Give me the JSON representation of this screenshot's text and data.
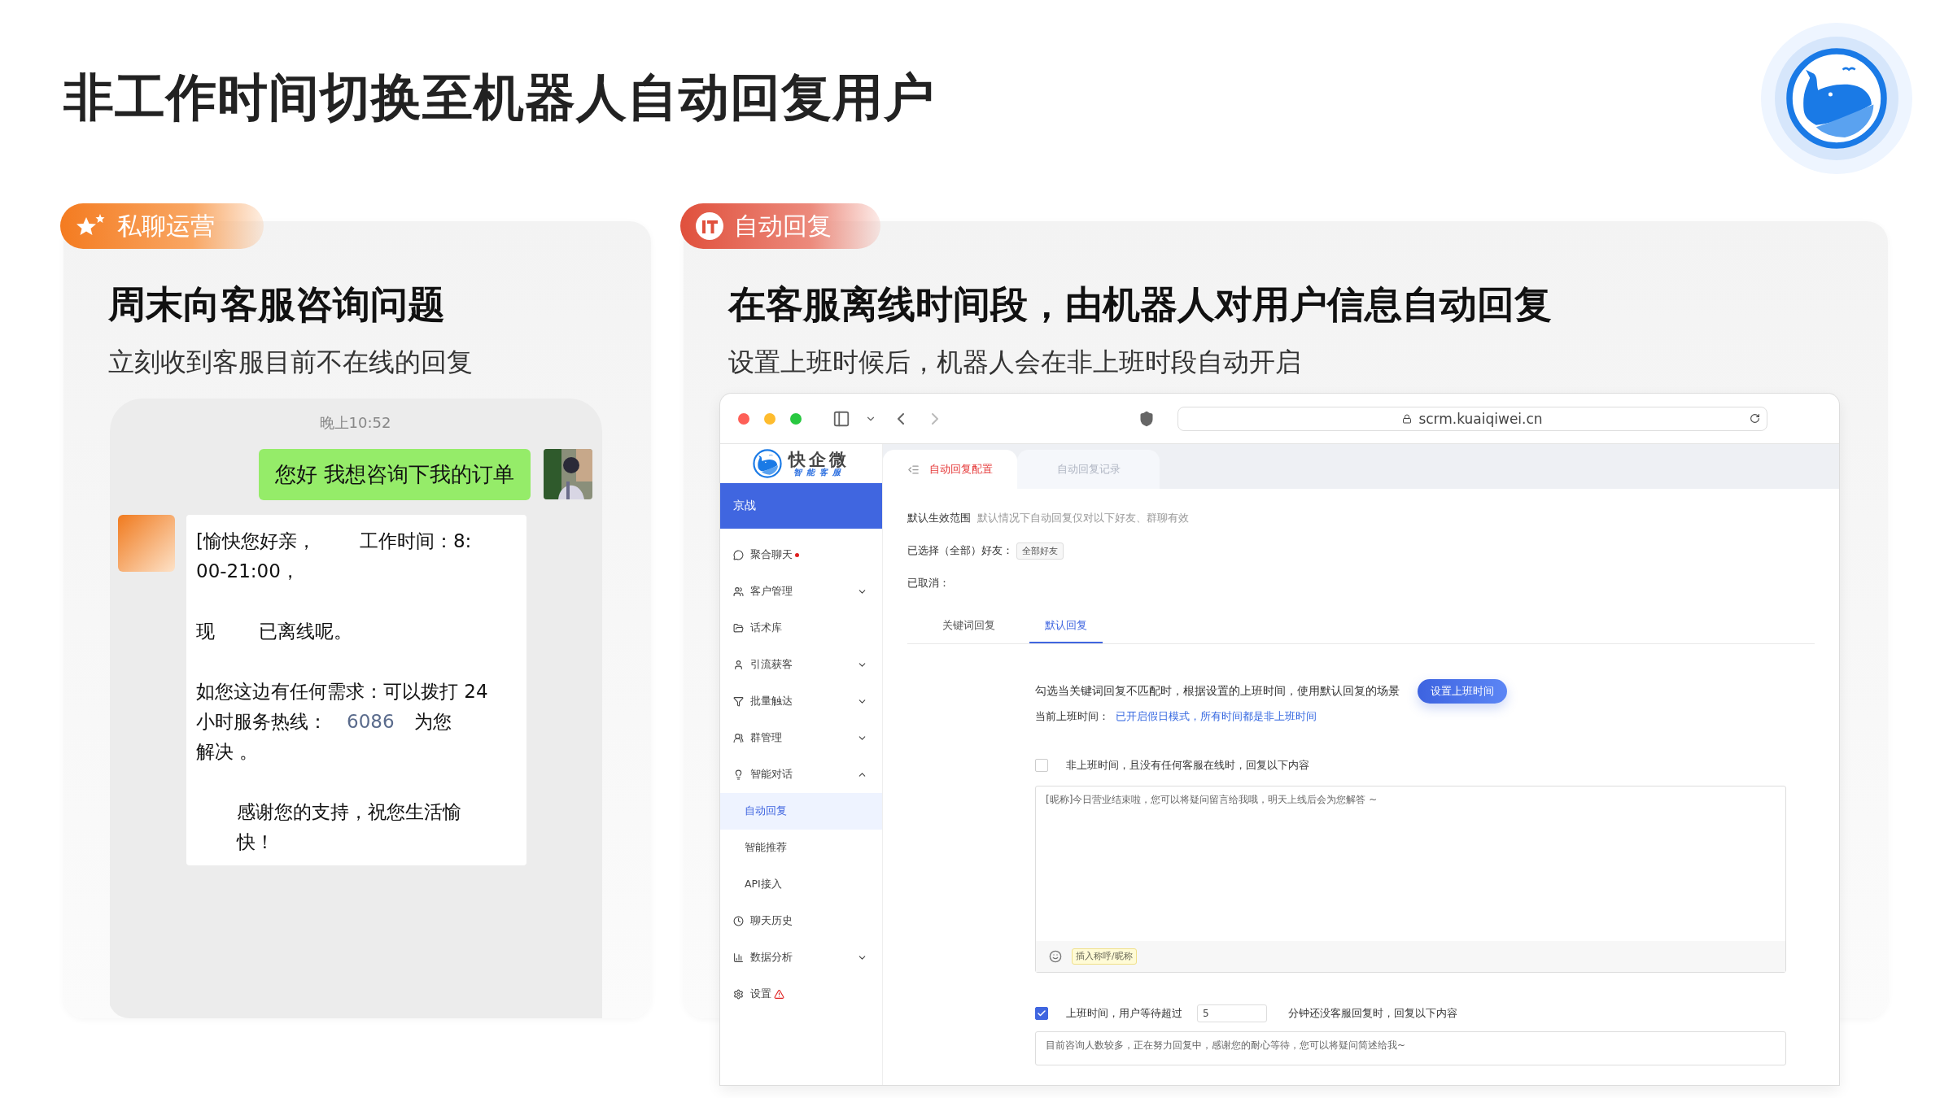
{
  "title": "非工作时间切换至机器人自动回复用户",
  "panels": [
    {
      "kind": "chat",
      "badge": {
        "label": "私聊运营",
        "kind": "star"
      },
      "heading": "周末向客服咨询问题",
      "subheading": "立刻收到客服目前不在线的回复",
      "chat": {
        "time": "晚上10:52",
        "outgoing": "您好 我想咨询下我的订单",
        "reply": [
          {
            "indent": false,
            "lines": [
              [
                {
                  "text": "[愉快您好亲，",
                  "highlight": false
                },
                {
                  "text": "工作时间：8:",
                  "highlight": false
                }
              ],
              [
                {
                  "text": "00-21:00，",
                  "highlight": false
                }
              ]
            ]
          },
          {
            "indent": false,
            "lines": [
              [
                {
                  "text": "现",
                  "highlight": false
                },
                {
                  "text": "已离线呢。",
                  "highlight": false
                }
              ]
            ]
          },
          {
            "indent": false,
            "lines": [
              [
                {
                  "text": "如您这边有任何需求：可以拨打 24",
                  "highlight": false
                }
              ],
              [
                {
                  "text": "小时服务热线：",
                  "highlight": false
                },
                {
                  "text": "6086",
                  "highlight": true
                },
                {
                  "text": "为您",
                  "highlight": false
                }
              ],
              [
                {
                  "text": "解决 。",
                  "highlight": false
                }
              ]
            ]
          },
          {
            "indent": true,
            "lines": [
              [
                {
                  "text": "感谢您的支持，祝您生活愉",
                  "highlight": false
                }
              ],
              [
                {
                  "text": "快！",
                  "highlight": false
                }
              ]
            ]
          }
        ]
      }
    },
    {
      "kind": "browser",
      "badge": {
        "label": "自动回复",
        "kind": "tile"
      },
      "heading": "在客服离线时间段，由机器人对用户信息自动回复",
      "subheading": "设置上班时候后，机器人会在非上班时段自动开启",
      "browser": {
        "url": "scrm.kuaiqiwei.cn",
        "brand": {
          "name": "快企微",
          "tagline": "智能客服"
        },
        "account": "京战",
        "nav": [
          {
            "label": "聚合聊天",
            "unread": true,
            "warning": false
          },
          {
            "label": "客户管理",
            "expanded": false,
            "unread": false,
            "warning": false
          },
          {
            "label": "话术库",
            "unread": false,
            "warning": false
          },
          {
            "label": "引流获客",
            "expanded": false,
            "unread": false,
            "warning": false
          },
          {
            "label": "批量触达",
            "expanded": false,
            "unread": false,
            "warning": false
          },
          {
            "label": "群管理",
            "expanded": false,
            "unread": false,
            "warning": false
          },
          {
            "label": "智能对话",
            "expanded": true,
            "unread": false,
            "warning": false,
            "children": [
              {
                "label": "自动回复",
                "selected": true
              },
              {
                "label": "智能推荐",
                "selected": false
              },
              {
                "label": "API接入",
                "selected": false
              }
            ]
          },
          {
            "label": "聊天历史",
            "unread": false,
            "warning": false
          },
          {
            "label": "数据分析",
            "expanded": false,
            "unread": false,
            "warning": false
          },
          {
            "label": "设置",
            "unread": false,
            "warning": true
          }
        ],
        "tabs": [
          {
            "label": "自动回复配置",
            "selected": true
          },
          {
            "label": "自动回复记录",
            "selected": false
          }
        ],
        "scope": {
          "label": "默认生效范围",
          "hint": "默认情况下自动回复仅对以下好友、群聊有效"
        },
        "selected_label": "已选择（全部）好友：",
        "selected_tag": "全部好友",
        "cancelled_label": "已取消：",
        "subtabs": [
          {
            "label": "关键词回复",
            "selected": false
          },
          {
            "label": "默认回复",
            "selected": true
          }
        ],
        "description": "勾选当关键词回复不匹配时，根据设置的上班时间，使用默认回复的场景",
        "set_time_button": "设置上班时间",
        "current_label": "当前上班时间：",
        "current_value": "已开启假日模式，所有时间都是非上班时间",
        "rules": [
          {
            "kind": "plain",
            "checked": false,
            "label": "非上班时间，且没有任何客服在线时，回复以下内容",
            "message": "[昵称]今日营业结束啦，您可以将疑问留言给我哦，明天上线后会为您解答 ~",
            "insert_button": "插入称呼/昵称"
          },
          {
            "kind": "timed",
            "checked": true,
            "label": "上班时间，用户等待超过",
            "minutes": "5",
            "label_after": "分钟还没客服回复时，回复以下内容",
            "message": "目前咨询人数较多，正在努力回复中，感谢您的耐心等待，您可以将疑问简述给我~"
          }
        ]
      }
    }
  ]
}
